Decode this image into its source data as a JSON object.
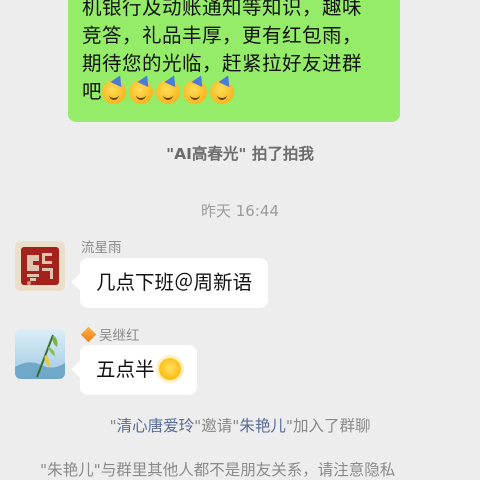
{
  "outgoing_message": {
    "lines": [
      "机银行及动账通知等知识，趣味",
      "竞答，礼品丰厚，更有红包雨，",
      "期待您的光临，赶紧拉好友进群",
      "吧"
    ],
    "emoji_icons": [
      "partying-face-icon",
      "partying-face-icon",
      "partying-face-icon",
      "partying-face-icon",
      "partying-face-icon"
    ]
  },
  "pat_notice": "\"AI高春光\" 拍了拍我",
  "timestamp": "昨天 16:44",
  "messages": [
    {
      "sender": "流星雨",
      "text": "几点下班＠周新语"
    },
    {
      "sender": "吴继红",
      "text": "五点半",
      "emoji": "sun-face-icon"
    }
  ],
  "invite_notice": {
    "q1": "\"",
    "inviter": "清心唐爱玲",
    "mid": "\"邀请\"",
    "invitee": "朱艳儿",
    "tail": "\"加入了群聊"
  },
  "privacy_notice": "\"朱艳儿\"与群里其他人都不是朋友关系，请注意隐私",
  "colors": {
    "background": "#ededed",
    "outgoing_bubble": "#95ec69",
    "incoming_bubble": "#ffffff",
    "link": "#576b95"
  }
}
